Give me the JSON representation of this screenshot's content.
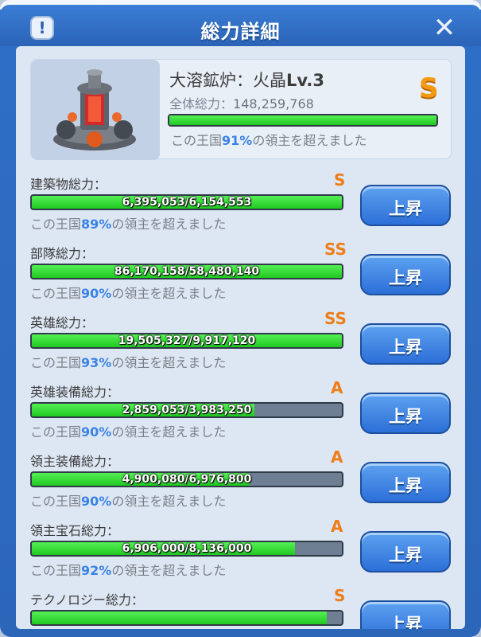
{
  "header": {
    "title": "総力詳細",
    "info_label": "!",
    "close_label": "✕"
  },
  "building": {
    "name": "大溶鉱炉：火晶",
    "level": "Lv.3",
    "grade": "S",
    "total_label": "全体総力：",
    "total_value": "148,259,768",
    "progress": 1.0,
    "rank_prefix": "この王国",
    "rank_pct": "91%",
    "rank_suffix": "の領主を超えました"
  },
  "button_label": "上昇",
  "stats": [
    {
      "label": "建築物総力：",
      "grade": "S",
      "value": "6,395,053/6,154,553",
      "progress": 1.0,
      "rank_prefix": "この王国",
      "rank_pct": "89%",
      "rank_suffix": "の領主を超えました"
    },
    {
      "label": "部隊総力：",
      "grade": "SS",
      "value": "86,170,158/58,480,140",
      "progress": 1.0,
      "rank_prefix": "この王国",
      "rank_pct": "90%",
      "rank_suffix": "の領主を超えました"
    },
    {
      "label": "英雄総力：",
      "grade": "SS",
      "value": "19,505,327/9,917,120",
      "progress": 1.0,
      "rank_prefix": "この王国",
      "rank_pct": "93%",
      "rank_suffix": "の領主を超えました"
    },
    {
      "label": "英雄装備総力：",
      "grade": "A",
      "value": "2,859,053/3,983,250",
      "progress": 0.718,
      "rank_prefix": "この王国",
      "rank_pct": "90%",
      "rank_suffix": "の領主を超えました"
    },
    {
      "label": "領主装備総力：",
      "grade": "A",
      "value": "4,900,080/6,976,800",
      "progress": 0.702,
      "rank_prefix": "この王国",
      "rank_pct": "90%",
      "rank_suffix": "の領主を超えました"
    },
    {
      "label": "領主宝石総力：",
      "grade": "A",
      "value": "6,906,000/8,136,000",
      "progress": 0.849,
      "rank_prefix": "この王国",
      "rank_pct": "92%",
      "rank_suffix": "の領主を超えました"
    },
    {
      "label": "テクノロジー総力：",
      "grade": "S",
      "value": "",
      "progress": 0.95,
      "rank_prefix": "",
      "rank_pct": "",
      "rank_suffix": ""
    }
  ],
  "colors": {
    "accent": "#3b82e6",
    "grade": "#ee7d1a",
    "bar_fill": "#21c821"
  }
}
